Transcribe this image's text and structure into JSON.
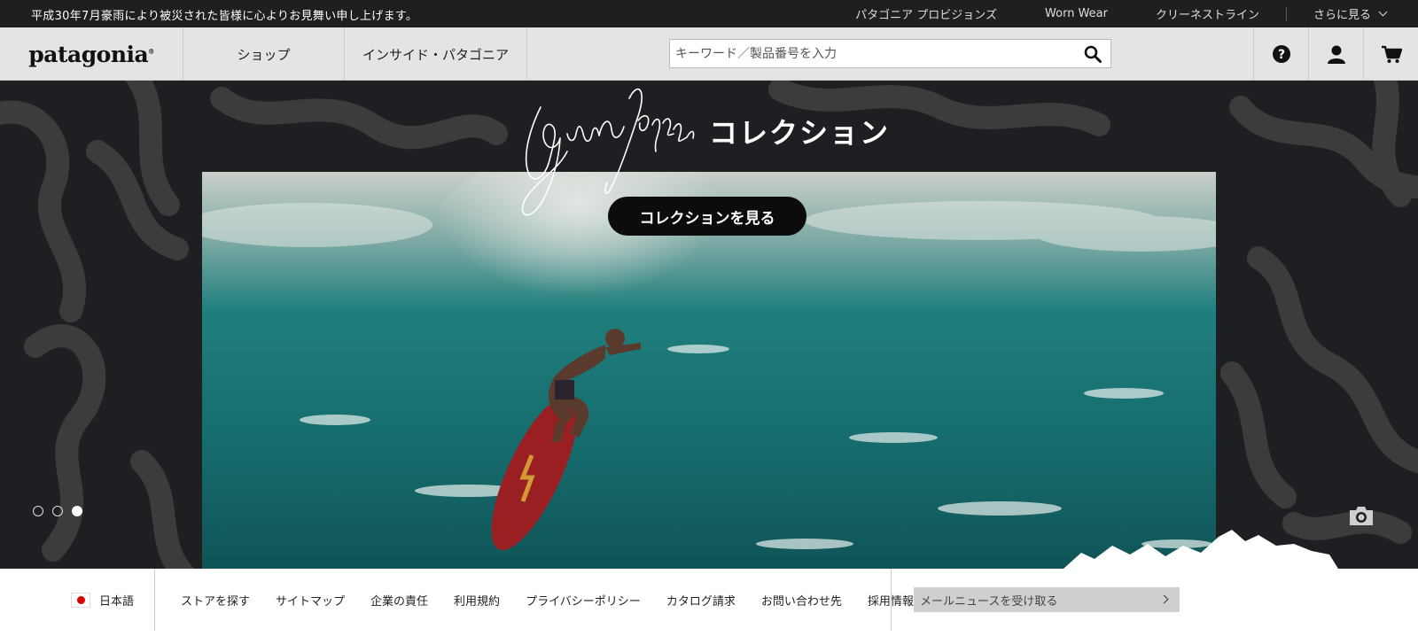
{
  "topbar": {
    "notice": "平成30年7月豪雨により被災された皆様に心よりお見舞い申し上げます。",
    "links": [
      "パタゴニア プロビジョンズ",
      "Worn Wear",
      "クリーネストライン"
    ],
    "more": "さらに見る"
  },
  "nav": {
    "logo": "patagonia",
    "shop": "ショップ",
    "inside": "インサイド・パタゴニア",
    "search_placeholder": "キーワード／製品番号を入力",
    "icons": [
      "search-icon",
      "help-icon",
      "account-icon",
      "cart-icon"
    ]
  },
  "hero": {
    "signature_icon": "gerry-lopez-signature",
    "heading": "コレクション",
    "cta": "コレクションを見る",
    "slides": 3,
    "active_slide": 3
  },
  "footer": {
    "language": "日本語",
    "links": [
      "ストアを探す",
      "サイトマップ",
      "企業の責任",
      "利用規約",
      "プライバシーポリシー",
      "カタログ請求",
      "お問い合わせ先",
      "採用情報"
    ],
    "newsletter": "メールニュースを受け取る"
  },
  "colors": {
    "topbar": "#1f1f1f",
    "nav": "#e4e4e2",
    "hero_bg": "#1d1f22",
    "wave": "#1f7f7d",
    "cta": "#0c0c0c"
  }
}
